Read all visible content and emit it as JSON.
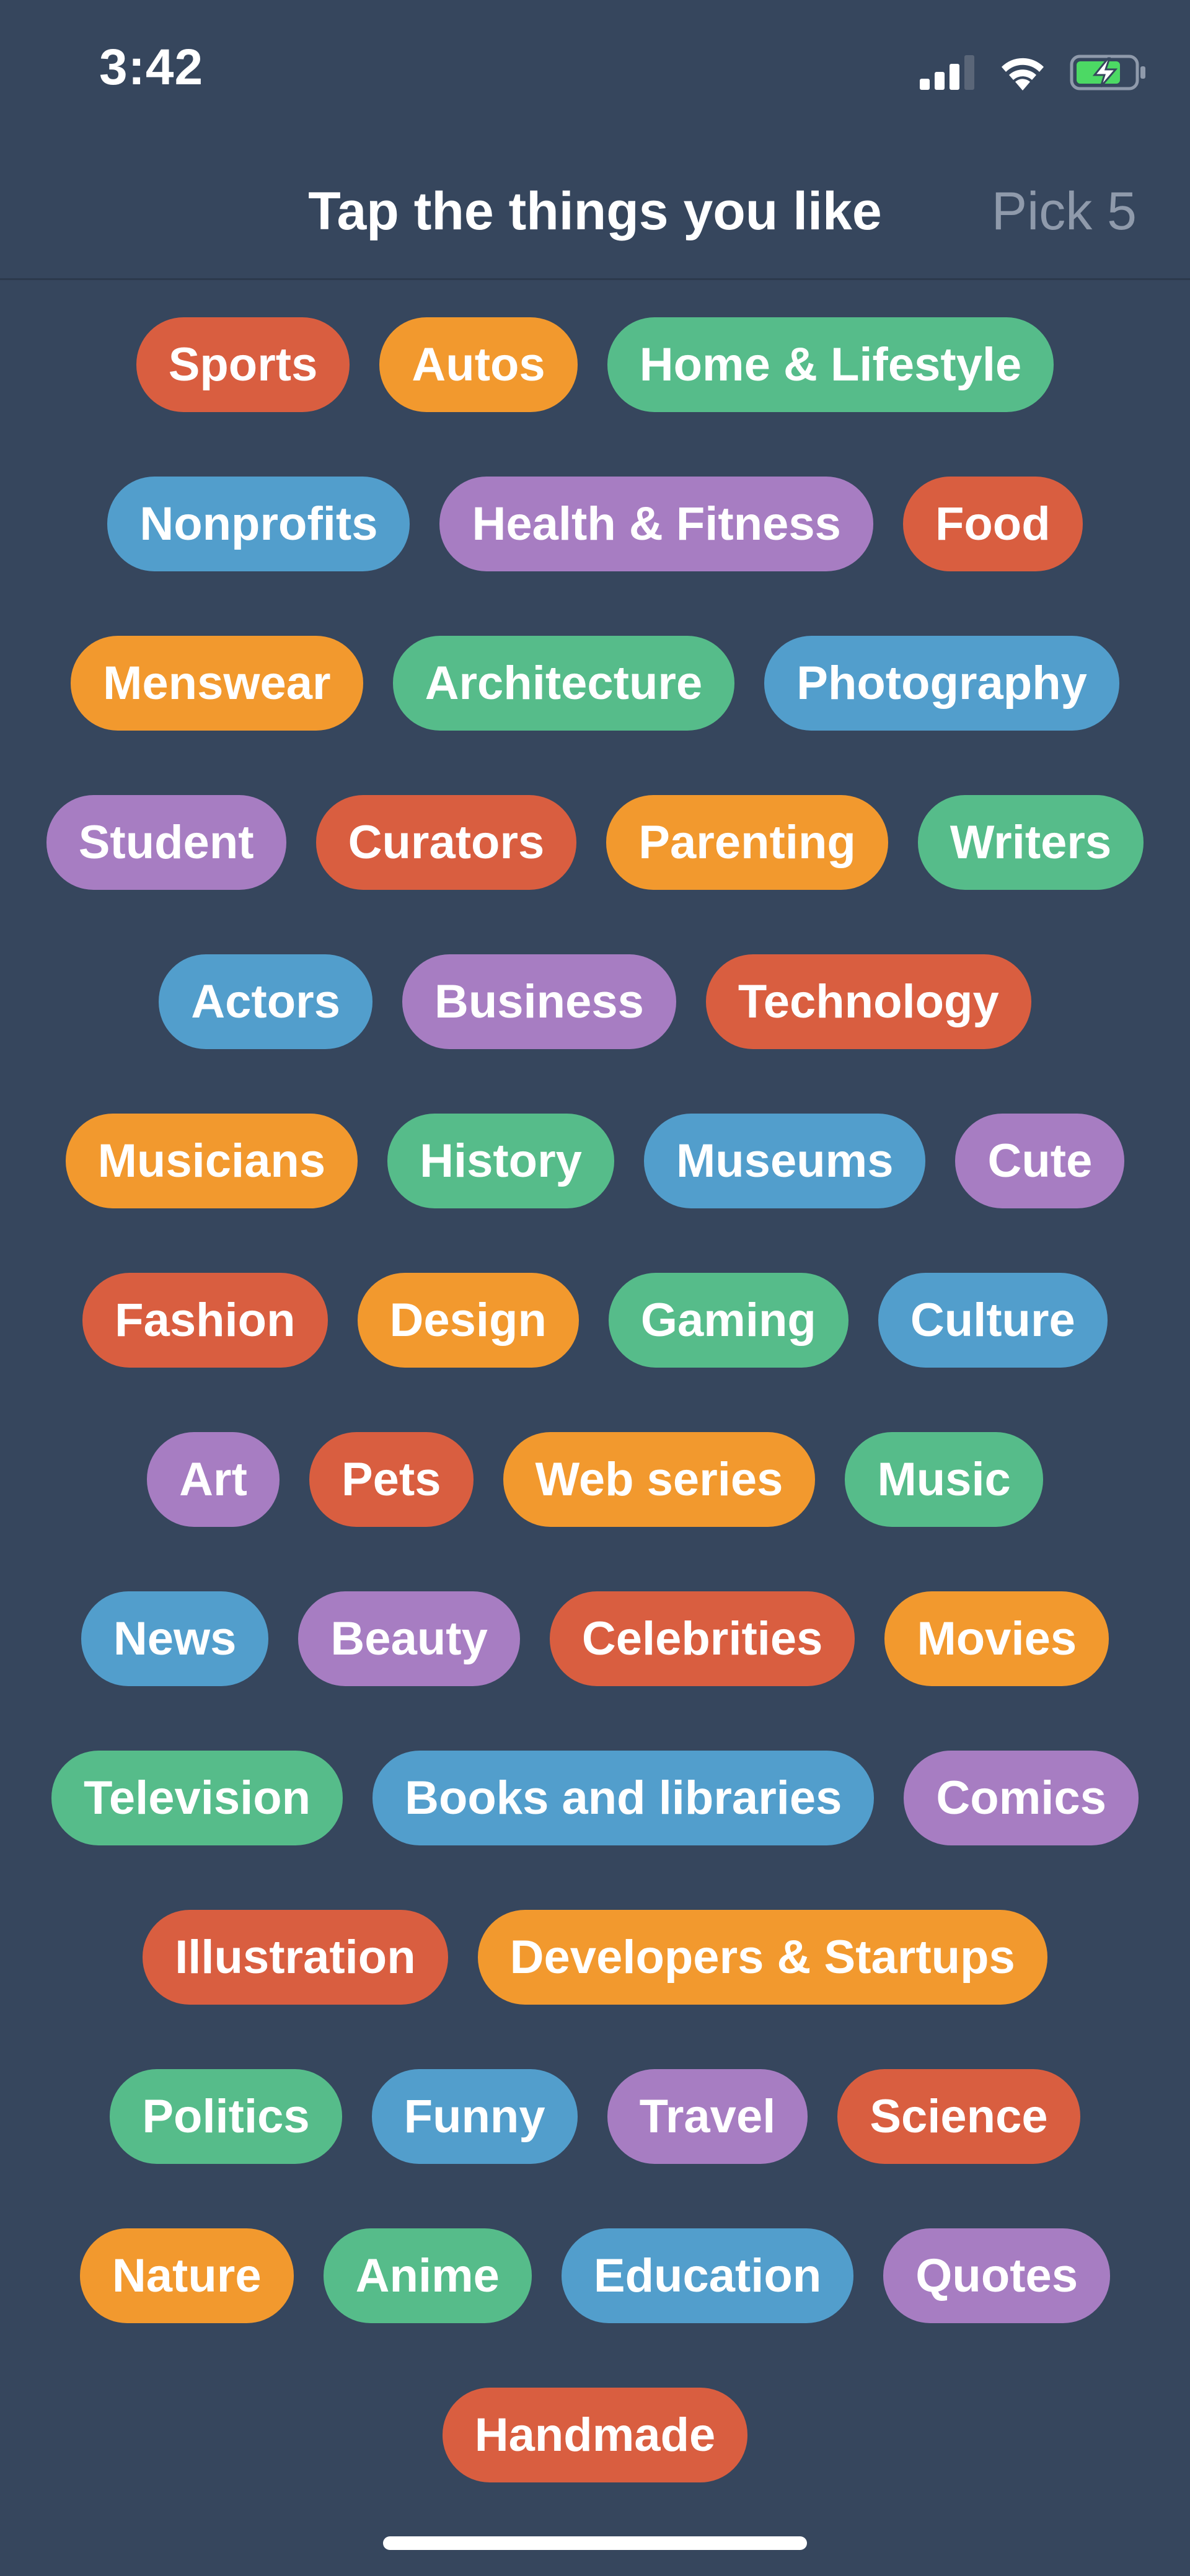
{
  "status_bar": {
    "time": "3:42",
    "icons": [
      "signal-icon",
      "wifi-icon",
      "battery-charging-icon"
    ]
  },
  "header": {
    "title": "Tap the things you like",
    "action": "Pick 5"
  },
  "colors": {
    "background": "#36465d",
    "red": "#d95e40",
    "orange": "#f2992e",
    "green": "#56bc8a",
    "blue": "#529ecc",
    "purple": "#a77dc2",
    "muted_text": "#8f9aab"
  },
  "tags": [
    {
      "label": "Sports",
      "color": "red"
    },
    {
      "label": "Autos",
      "color": "orange"
    },
    {
      "label": "Home & Lifestyle",
      "color": "green"
    },
    {
      "label": "Nonprofits",
      "color": "blue"
    },
    {
      "label": "Health & Fitness",
      "color": "purple"
    },
    {
      "label": "Food",
      "color": "red"
    },
    {
      "label": "Menswear",
      "color": "orange"
    },
    {
      "label": "Architecture",
      "color": "green"
    },
    {
      "label": "Photography",
      "color": "blue"
    },
    {
      "label": "Student",
      "color": "purple"
    },
    {
      "label": "Curators",
      "color": "red"
    },
    {
      "label": "Parenting",
      "color": "orange"
    },
    {
      "label": "Writers",
      "color": "green"
    },
    {
      "label": "Actors",
      "color": "blue"
    },
    {
      "label": "Business",
      "color": "purple"
    },
    {
      "label": "Technology",
      "color": "red"
    },
    {
      "label": "Musicians",
      "color": "orange"
    },
    {
      "label": "History",
      "color": "green"
    },
    {
      "label": "Museums",
      "color": "blue"
    },
    {
      "label": "Cute",
      "color": "purple"
    },
    {
      "label": "Fashion",
      "color": "red"
    },
    {
      "label": "Design",
      "color": "orange"
    },
    {
      "label": "Gaming",
      "color": "green"
    },
    {
      "label": "Culture",
      "color": "blue"
    },
    {
      "label": "Art",
      "color": "purple"
    },
    {
      "label": "Pets",
      "color": "red"
    },
    {
      "label": "Web series",
      "color": "orange"
    },
    {
      "label": "Music",
      "color": "green"
    },
    {
      "label": "News",
      "color": "blue"
    },
    {
      "label": "Beauty",
      "color": "purple"
    },
    {
      "label": "Celebrities",
      "color": "red"
    },
    {
      "label": "Movies",
      "color": "orange"
    },
    {
      "label": "Television",
      "color": "green"
    },
    {
      "label": "Books and libraries",
      "color": "blue"
    },
    {
      "label": "Comics",
      "color": "purple"
    },
    {
      "label": "Illustration",
      "color": "red"
    },
    {
      "label": "Developers & Startups",
      "color": "orange"
    },
    {
      "label": "Politics",
      "color": "green"
    },
    {
      "label": "Funny",
      "color": "blue"
    },
    {
      "label": "Travel",
      "color": "purple"
    },
    {
      "label": "Science",
      "color": "red"
    },
    {
      "label": "Nature",
      "color": "orange"
    },
    {
      "label": "Anime",
      "color": "green"
    },
    {
      "label": "Education",
      "color": "blue"
    },
    {
      "label": "Quotes",
      "color": "purple"
    },
    {
      "label": "Handmade",
      "color": "red"
    }
  ]
}
